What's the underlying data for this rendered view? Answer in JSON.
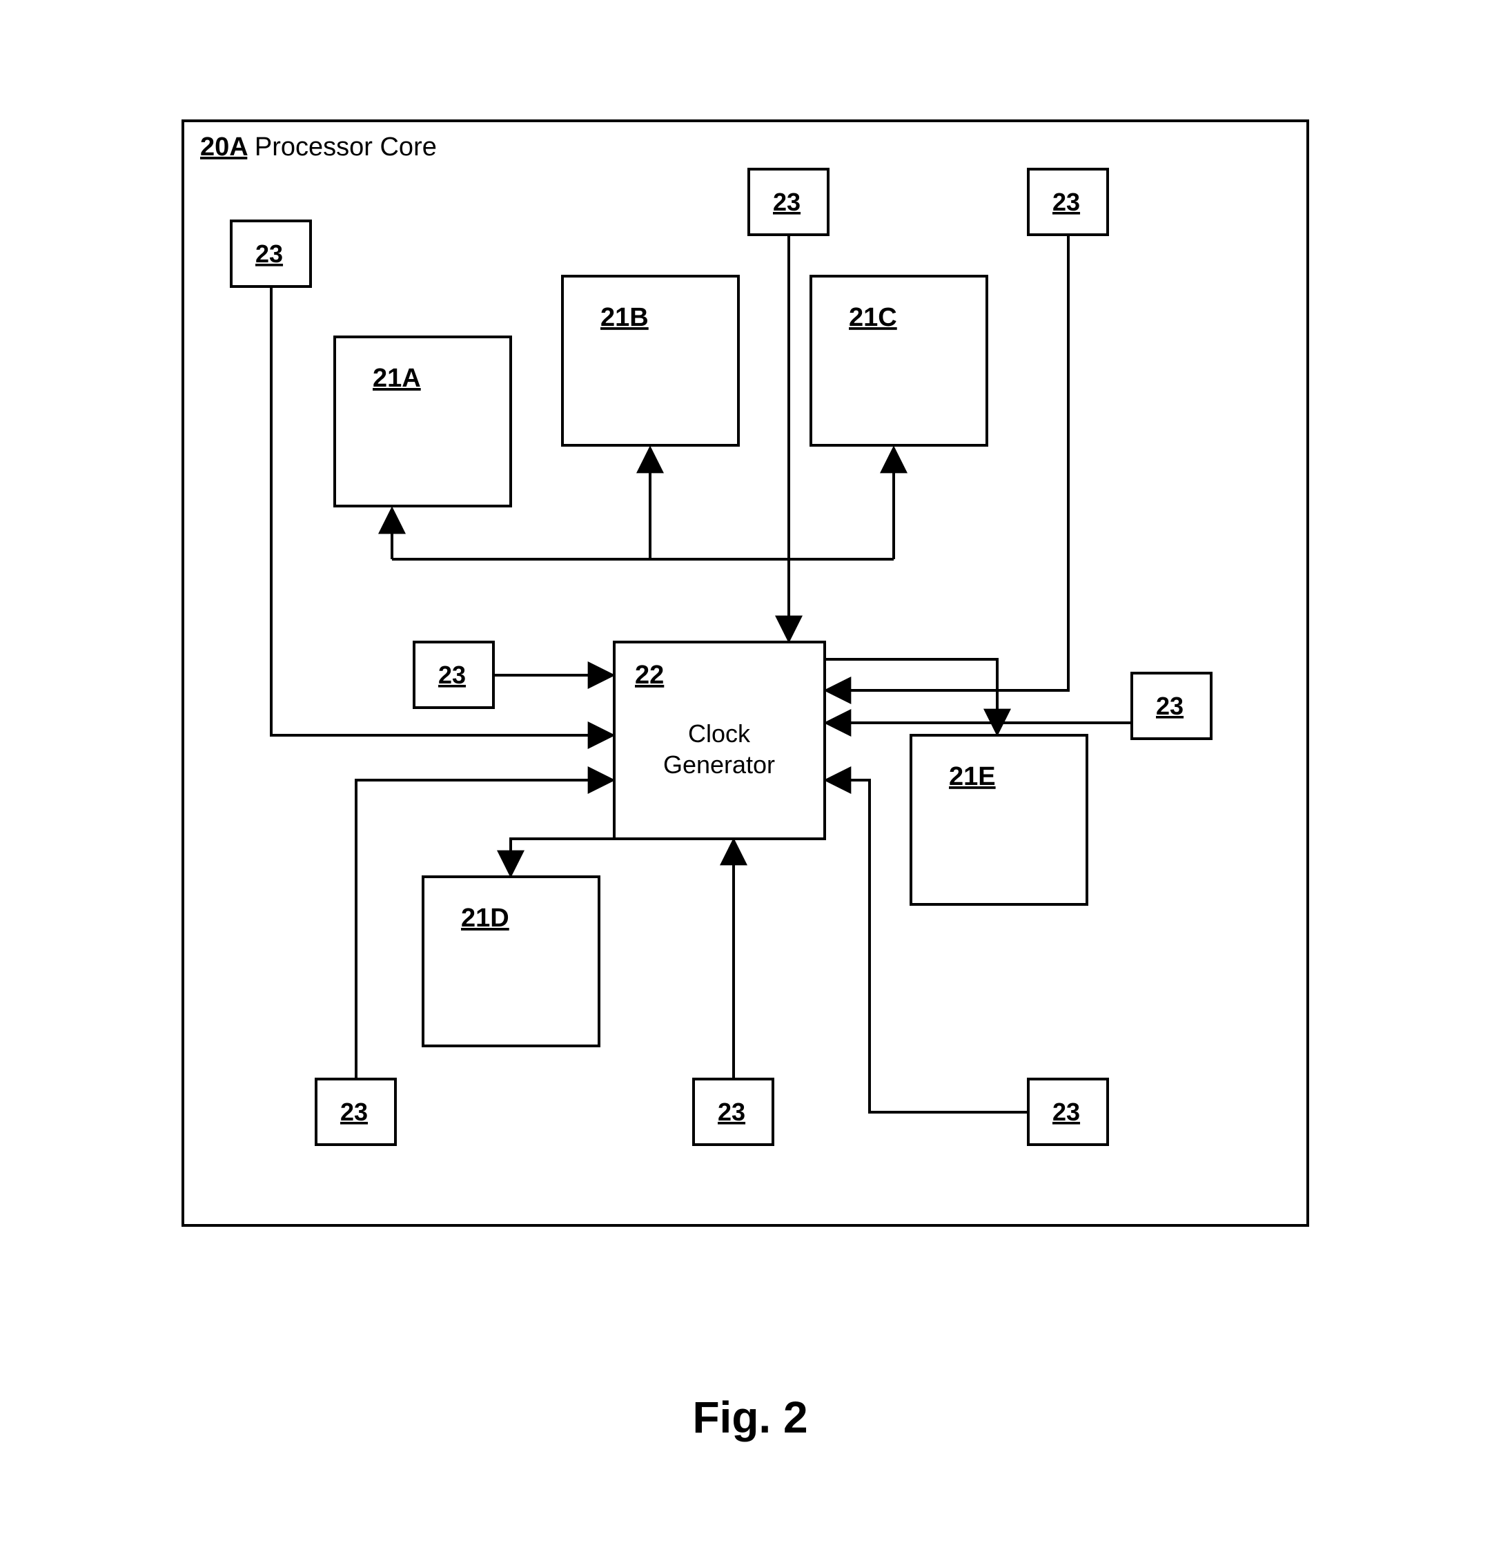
{
  "figure_label": "Fig. 2",
  "container": {
    "ref": "20A",
    "name": "Processor Core"
  },
  "center_block": {
    "ref": "22",
    "name_line1": "Clock",
    "name_line2": "Generator"
  },
  "func_blocks": {
    "a": "21A",
    "b": "21B",
    "c": "21C",
    "d": "21D",
    "e": "21E"
  },
  "sensor_label": "23"
}
